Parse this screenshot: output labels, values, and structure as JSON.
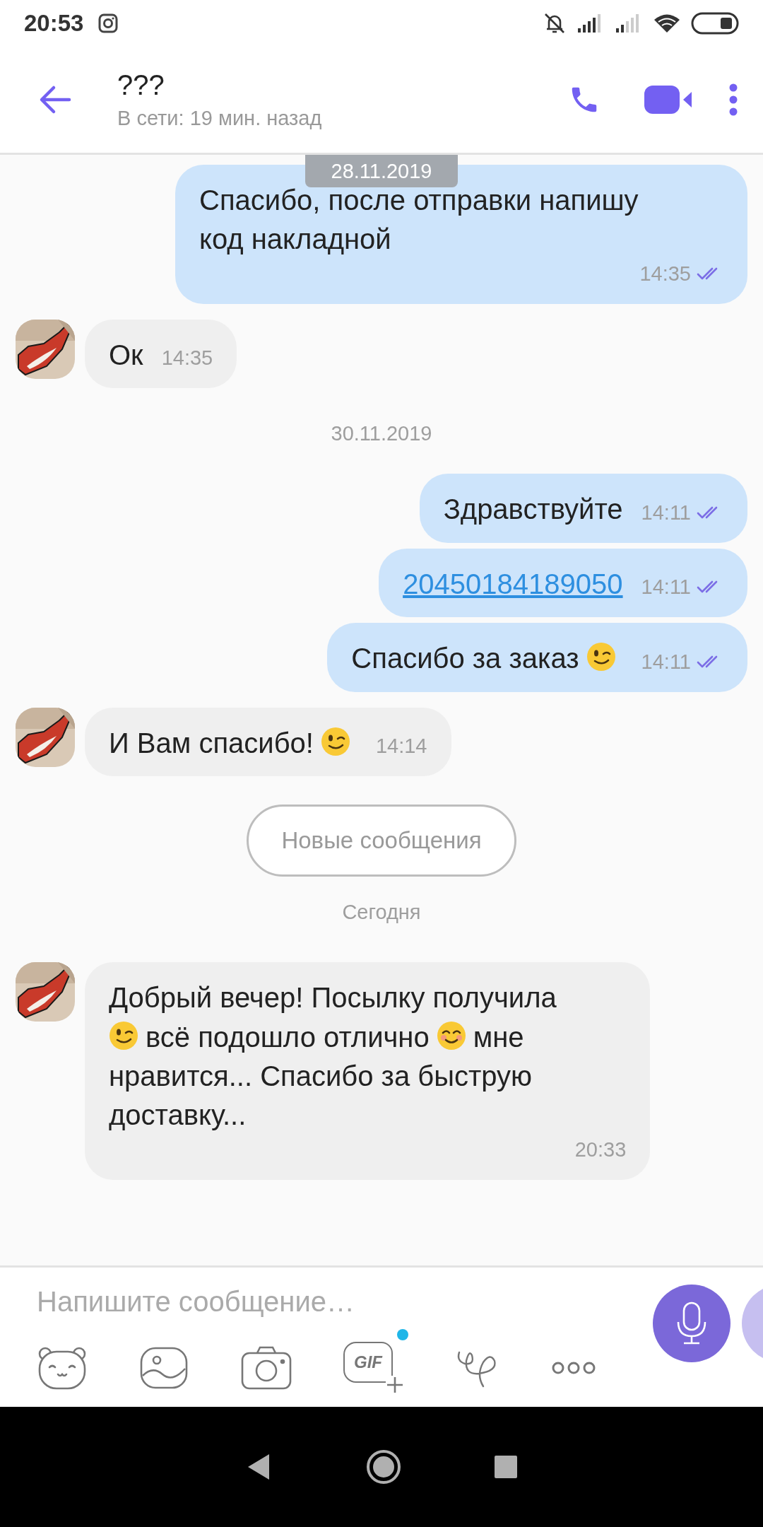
{
  "status_bar": {
    "time": "20:53"
  },
  "header": {
    "title": "???",
    "subtitle": "В сети: 19 мин. назад"
  },
  "sticky_date": "28.11.2019",
  "feed": [
    {
      "kind": "outgoing",
      "lines": [
        [
          {
            "kind": "text",
            "text": "Спасибо, после отправки напишу"
          }
        ],
        [
          {
            "kind": "text",
            "text": "код накладной"
          }
        ]
      ],
      "time": "14:35",
      "read": true
    },
    {
      "kind": "incoming",
      "lines": [
        [
          {
            "kind": "text",
            "text": "Ок"
          }
        ]
      ],
      "time": "14:35"
    },
    {
      "kind": "date",
      "text": "30.11.2019"
    },
    {
      "kind": "outgoing",
      "lines": [
        [
          {
            "kind": "text",
            "text": "Здравствуйте"
          }
        ]
      ],
      "time": "14:11",
      "read": true
    },
    {
      "kind": "outgoing",
      "lines": [
        [
          {
            "kind": "link",
            "text": "20450184189050"
          }
        ]
      ],
      "time": "14:11",
      "read": true
    },
    {
      "kind": "outgoing",
      "lines": [
        [
          {
            "kind": "text",
            "text": "Спасибо за заказ"
          },
          {
            "kind": "wink"
          }
        ]
      ],
      "time": "14:11",
      "read": true
    },
    {
      "kind": "incoming",
      "lines": [
        [
          {
            "kind": "text",
            "text": "И Вам спасибо!"
          },
          {
            "kind": "wink"
          }
        ]
      ],
      "time": "14:14"
    },
    {
      "kind": "new-messages",
      "text": "Новые сообщения"
    },
    {
      "kind": "date",
      "text": "Сегодня"
    },
    {
      "kind": "incoming",
      "lines": [
        [
          {
            "kind": "text",
            "text": "Добрый вечер! Посылку получила"
          }
        ],
        [
          {
            "kind": "wink"
          },
          {
            "kind": "text",
            "text": "всё подошло отлично"
          },
          {
            "kind": "smile"
          },
          {
            "kind": "text",
            "text": "мне"
          }
        ],
        [
          {
            "kind": "text",
            "text": "нравится... Спасибо за быструю"
          }
        ],
        [
          {
            "kind": "text",
            "text": "доставку..."
          }
        ]
      ],
      "time": "20:33"
    }
  ],
  "composer": {
    "placeholder": "Напишите сообщение…",
    "gif_label": "GIF",
    "gif_new": true
  }
}
